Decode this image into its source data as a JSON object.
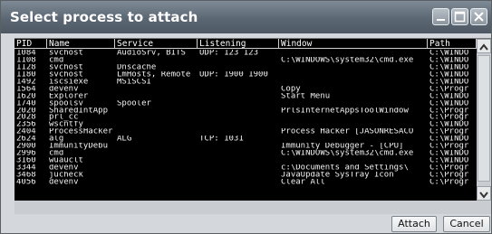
{
  "window": {
    "title": "Select process to attach"
  },
  "columns": [
    "PID",
    "Name",
    "Service",
    "Listening",
    "Window",
    "Path"
  ],
  "rows": [
    [
      "1084",
      "svchost",
      "AudioSrv, BITS",
      "UDP: 123 123",
      "",
      "C:\\WINDO"
    ],
    [
      "1108",
      "cmd",
      "",
      "",
      "C:\\WINDOWS\\system32\\cmd.exe",
      "C:\\WINDO"
    ],
    [
      "1128",
      "svchost",
      "Dnscache",
      "",
      "",
      "C:\\WINDO"
    ],
    [
      "1180",
      "svchost",
      "LmHosts, Remote",
      "UDP: 1900 1900",
      "",
      "C:\\WINDO"
    ],
    [
      "1492",
      "iscsiexe",
      "MSiSCSI",
      "",
      "",
      "C:\\WINDO"
    ],
    [
      "1564",
      "devenv",
      "",
      "",
      "Copy",
      "C:\\Progr"
    ],
    [
      "1620",
      "Explorer",
      "",
      "",
      "Start Menu",
      "C:\\WINDO"
    ],
    [
      "1740",
      "spoolsv",
      "Spooler",
      "",
      "",
      "C:\\WINDO"
    ],
    [
      "2020",
      "SharedIntApp",
      "",
      "",
      "PrlsInternetAppsToolWindow",
      "C:\\Progr"
    ],
    [
      "2028",
      "prl_cc",
      "",
      "",
      "",
      "C:\\Progr"
    ],
    [
      "2356",
      "wscntfy",
      "",
      "",
      "",
      "C:\\WINDO"
    ],
    [
      "2404",
      "ProcessHacker",
      "",
      "",
      "Process Hacker [JASONRESACO",
      "C:\\Progr"
    ],
    [
      "2624",
      "alg",
      "ALG",
      "TCP: 1031",
      "",
      "C:\\WINDO"
    ],
    [
      "2900",
      "ImmunityDebu",
      "",
      "",
      "Immunity Debugger - [CPU]",
      "C:\\Progr"
    ],
    [
      "2996",
      "cmd",
      "",
      "",
      "C:\\WINDOWS\\system32\\cmd.exe",
      "C:\\WINDO"
    ],
    [
      "3160",
      "wuauclt",
      "",
      "",
      "",
      "C:\\WINDO"
    ],
    [
      "3344",
      "devenv",
      "",
      "",
      "c:\\Documents and Settings\\",
      "C:\\Progr"
    ],
    [
      "3468",
      "jucheck",
      "",
      "",
      "JavaUpdate SysTray Icon",
      "C:\\Progr"
    ],
    [
      "4056",
      "devenv",
      "",
      "",
      "Clear All",
      "C:\\Progr"
    ]
  ],
  "buttons": {
    "attach": "Attach",
    "cancel": "Cancel"
  },
  "icons": {
    "minimize": "minimize-icon",
    "maximize": "maximize-icon",
    "close": "close-icon"
  }
}
